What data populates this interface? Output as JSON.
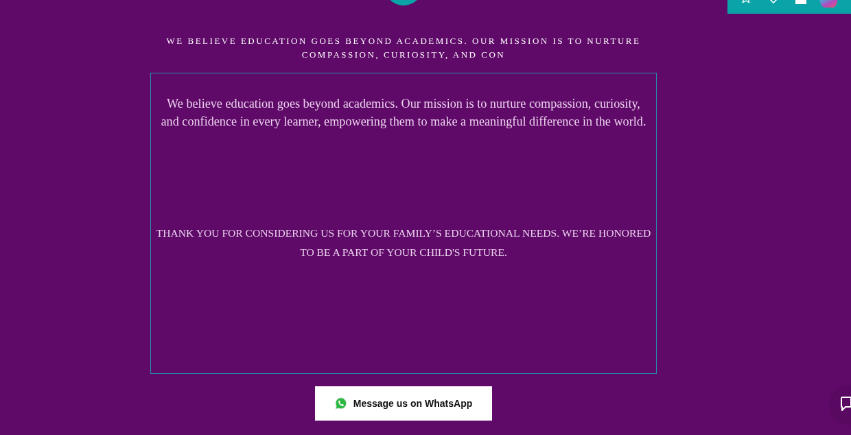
{
  "heading": "WE BELIEVE EDUCATION GOES BEYOND ACADEMICS. OUR MISSION IS TO NURTURE COMPASSION, CURIOSITY, AND CON",
  "content_box": {
    "paragraphs": [
      {
        "kind": "lead",
        "text": "We believe education goes beyond academics. Our mission is to nurture compassion, curiosity, and confidence in every learner, empowering them to make a meaningful difference in the world."
      },
      {
        "kind": "closing",
        "text": "THANK YOU FOR CONSIDERING US FOR YOUR FAMILY’S EDUCATIONAL NEEDS. WE’RE HONORED TO BE A PART OF YOUR CHILD'S FUTURE."
      }
    ]
  },
  "whatsapp_button": {
    "label": "Message us on WhatsApp"
  }
}
